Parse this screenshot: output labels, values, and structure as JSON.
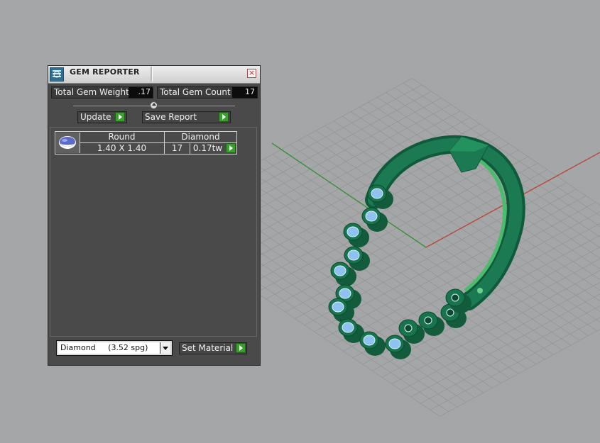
{
  "colors": {
    "viewport_bg": "#a4a6a7",
    "grid_line": "#939597",
    "x_axis": "#b84a3c",
    "y_axis": "#3c8f3c",
    "model_green": "#17744c",
    "gem_blue": "#8ec3f0",
    "panel_bg": "#4a4a4a",
    "accent_green": "#3aa02d"
  },
  "panel": {
    "title": "GEM REPORTER",
    "close_icon": "close-icon",
    "app_icon": "gem-reporter-icon",
    "total_weight_label": "Total Gem Weight",
    "total_weight_value": ".17",
    "total_count_label": "Total Gem Count",
    "total_count_value": "17",
    "update_label": "Update",
    "save_report_label": "Save Report"
  },
  "gem_table": {
    "rows": [
      {
        "shape": "Round",
        "material": "Diamond",
        "size": "1.40 X 1.40",
        "count": "17",
        "weight": "0.17tw"
      }
    ]
  },
  "material_select": {
    "selected": "Diamond     (3.52 spg)"
  },
  "set_material_label": "Set Material"
}
